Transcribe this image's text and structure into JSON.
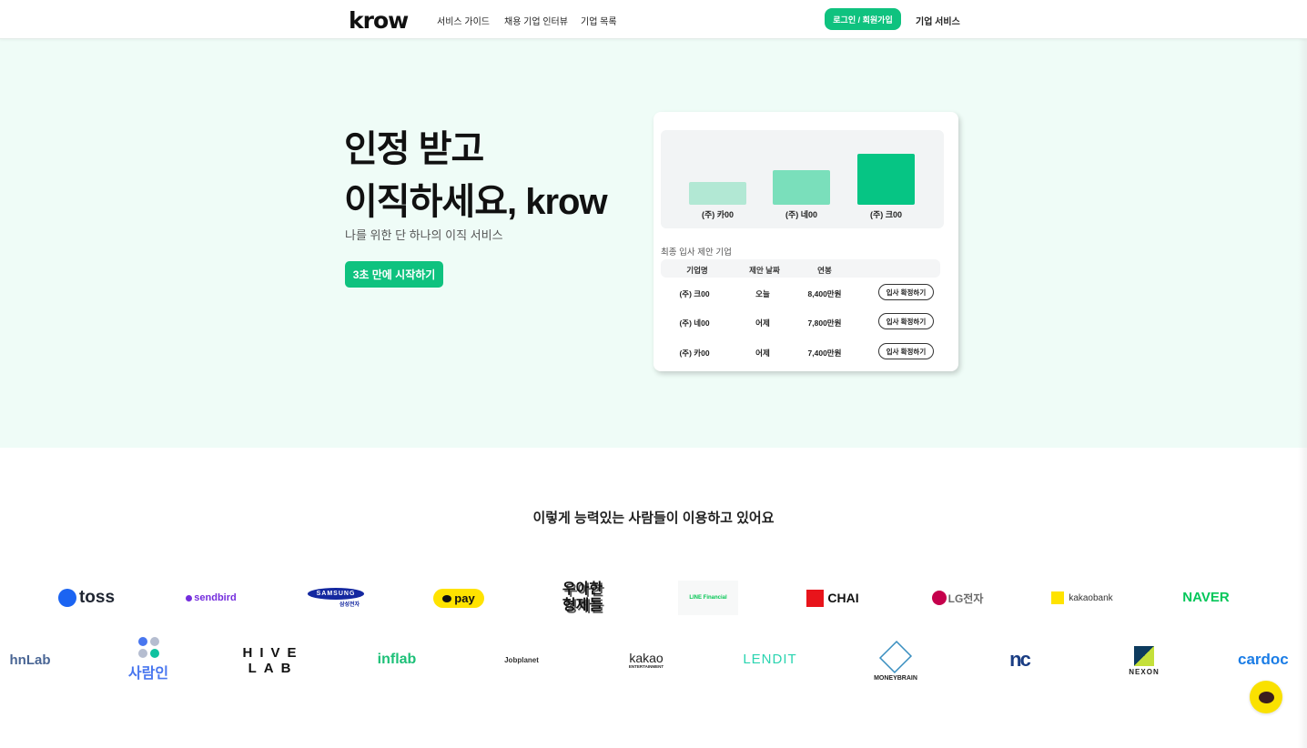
{
  "header": {
    "logo": "krow",
    "nav": [
      "서비스 가이드",
      "채용 기업 인터뷰",
      "기업 목록"
    ],
    "login_label": "로그인 / 회원가입",
    "corp_service_label": "기업 서비스"
  },
  "hero": {
    "title_line1": "인정 받고",
    "title_line2": "이직하세요, krow",
    "subtitle": "나를 위한 단 하나의 이직 서비스",
    "cta_label": "3초 만에 시작하기"
  },
  "card": {
    "bars": [
      {
        "label": "(주) 카00",
        "value": 7400,
        "color": "#b2e8d4"
      },
      {
        "label": "(주) 네00",
        "value": 7800,
        "color": "#7adfbb"
      },
      {
        "label": "(주) 크00",
        "value": 8400,
        "color": "#06c584"
      }
    ],
    "caption": "최종 입사 제안 기업",
    "columns": [
      "기업명",
      "제안 날짜",
      "연봉"
    ],
    "rows": [
      {
        "company": "(주) 크00",
        "date": "오늘",
        "salary": "8,400만원",
        "action": "입사 확정하기"
      },
      {
        "company": "(주) 네00",
        "date": "어제",
        "salary": "7,800만원",
        "action": "입사 확정하기"
      },
      {
        "company": "(주) 카00",
        "date": "어제",
        "salary": "7,400만원",
        "action": "입사 확정하기"
      }
    ]
  },
  "partners": {
    "title": "이렇게 능력있는 사람들이 이용하고 있어요",
    "row1": [
      "toss",
      "sendbird",
      "SAMSUNG",
      "pay",
      "우아한 형제들",
      "LINE Financial",
      "CHAI",
      "LG전자",
      "kakaobank",
      "NAVER"
    ],
    "row2": [
      "hnLab",
      "사람인",
      "HIVE LAB",
      "inflab",
      "Jobplanet",
      "kakao",
      "LENDIT",
      "MONEYBRAIN",
      "nc",
      "NEXON",
      "cardoc"
    ],
    "samsung_sub": "삼성전자",
    "kakao_sub": "ENTERTAINMENT"
  },
  "chat_button": "kakao-chat"
}
